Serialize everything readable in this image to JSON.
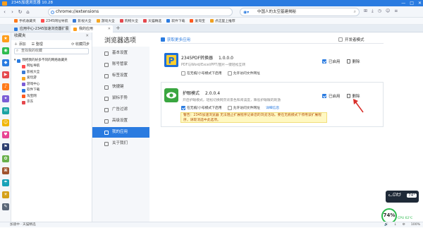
{
  "window": {
    "title": "2345加速浏览器 10.28",
    "controls": [
      "—",
      "□",
      "✕"
    ]
  },
  "address": {
    "url": "chrome://extensions",
    "search_value": "中国人的太空基建揭秘",
    "nav": [
      "‹",
      "›",
      "↻",
      "⌂"
    ]
  },
  "bookmarks": [
    {
      "label": "手机收藏夹",
      "color": "#ff7a1a"
    },
    {
      "label": "2345网址导航",
      "color": "#ff4d4f"
    },
    {
      "label": "影视大全",
      "color": "#3a7bd5"
    },
    {
      "label": "游戏大全",
      "color": "#f5a623"
    },
    {
      "label": "购物大全",
      "color": "#e5484d"
    },
    {
      "label": "天猫精选",
      "color": "#e5484d"
    },
    {
      "label": "软件下载",
      "color": "#2a7be0"
    },
    {
      "label": "爱淘宝",
      "color": "#ff5a1f"
    },
    {
      "label": "点这里上推荐",
      "color": "#f0a020"
    }
  ],
  "tabs": [
    {
      "label": "应用中心-2345加速浏览器扩展",
      "active": false
    },
    {
      "label": "我的应用",
      "active": true
    }
  ],
  "favorites": {
    "title": "收藏夹",
    "add_label": "添加",
    "manage_label": "整理",
    "sync_label": "收藏同步",
    "search_placeholder": "查找我的收藏",
    "root_label": "我把我的好多不同的网络收藏夹",
    "items": [
      {
        "label": "网址导航",
        "color": "#ff4d4f"
      },
      {
        "label": "影视大全",
        "color": "#3a7bd5"
      },
      {
        "label": "爱玩游",
        "color": "#f5a623"
      },
      {
        "label": "游戏中心",
        "color": "#7b5cd6"
      },
      {
        "label": "软件下载",
        "color": "#2a7be0"
      },
      {
        "label": "淘宝网",
        "color": "#ff5a1f"
      },
      {
        "label": "京东",
        "color": "#e5484d"
      }
    ]
  },
  "settings": {
    "title": "浏览器选项",
    "get_more": "获取更多应用",
    "dev_mode": "开发者模式",
    "nav": [
      {
        "label": "基本设置",
        "active": false
      },
      {
        "label": "账号管家",
        "active": false
      },
      {
        "label": "标签设置",
        "active": false
      },
      {
        "label": "快捷键",
        "active": false
      },
      {
        "label": "鼠标手势",
        "active": false
      },
      {
        "label": "广告过滤",
        "active": false
      },
      {
        "label": "高级设置",
        "active": false
      },
      {
        "label": "我的应用",
        "active": true
      },
      {
        "label": "关于我们",
        "active": false
      }
    ]
  },
  "extensions": [
    {
      "name": "2345PDF转换器",
      "version": "1.0.0.0",
      "desc": "PDF与Word/Excel/PPT/图片一键轻松互转",
      "opt1": "在无痕/小号模式下启用",
      "opt2": "允许访问文件网址",
      "enabled_label": "已启用",
      "delete_label": "删除",
      "opt1_checked": false,
      "opt2_checked": false
    },
    {
      "name": "护眼模式",
      "version": "2.0.0.4",
      "desc": "开启护眼模式，轻松切换网页背景色和阅读度，降低护眼眼的刺激",
      "opt1": "在无痕/小号模式下启用",
      "opt2": "允许访问文件网址",
      "details": "详细信息",
      "warning": "警告：2345加速浏览器 无法阻止扩展程序记录您的浏览活动。要在无痕模式下停用该扩展程序，请取消选中此选项。",
      "enabled_label": "已启用",
      "delete_label": "删除",
      "opt1_checked": true,
      "opt2_checked": false
    }
  ],
  "leftbar_icons": [
    {
      "name": "star-icon",
      "color": "#ff9e1b",
      "glyph": "★"
    },
    {
      "name": "app-green-icon",
      "color": "#2dbb4d",
      "glyph": "◉"
    },
    {
      "name": "app-blue-icon",
      "color": "#2a7be0",
      "glyph": "◆"
    },
    {
      "name": "app-red-icon",
      "color": "#e5484d",
      "glyph": "▶"
    },
    {
      "name": "app-orange-icon",
      "color": "#ff7a1a",
      "glyph": "♪"
    },
    {
      "name": "app-purple-icon",
      "color": "#7b5cd6",
      "glyph": "✦"
    },
    {
      "name": "app-teal-icon",
      "color": "#1aa3a3",
      "glyph": "✉"
    },
    {
      "name": "app-yellow-icon",
      "color": "#f0b400",
      "glyph": "☺"
    },
    {
      "name": "app-pink-icon",
      "color": "#e84393",
      "glyph": "♥"
    },
    {
      "name": "app-navy-icon",
      "color": "#2c3e70",
      "glyph": "⚑"
    },
    {
      "name": "app-lime-icon",
      "color": "#6ab04c",
      "glyph": "✿"
    },
    {
      "name": "app-brown-icon",
      "color": "#a0522d",
      "glyph": "⌘"
    },
    {
      "name": "app-cyan-icon",
      "color": "#17a2b8",
      "glyph": "☂"
    },
    {
      "name": "app-gold-icon",
      "color": "#d4a017",
      "glyph": "☀"
    },
    {
      "name": "app-slate-icon",
      "color": "#5a6778",
      "glyph": "✎"
    }
  ],
  "widget": {
    "temp_label": "74°",
    "percent": "74%",
    "cpu_label": "CPU 62℃"
  },
  "status": {
    "left": "加速中 · 天猫精选",
    "right": [
      "🔊",
      "↓",
      "⚙",
      "100%"
    ]
  }
}
